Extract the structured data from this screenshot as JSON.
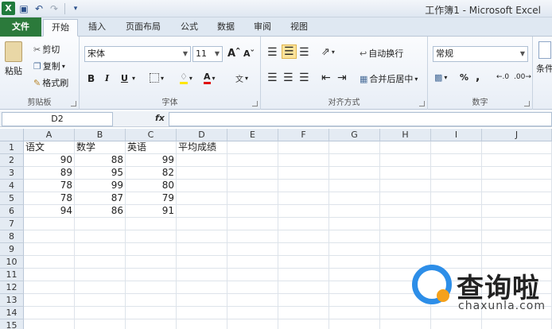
{
  "window": {
    "title": "工作簿1 - Microsoft Excel"
  },
  "tabs": [
    {
      "label": "文件"
    },
    {
      "label": "开始"
    },
    {
      "label": "插入"
    },
    {
      "label": "页面布局"
    },
    {
      "label": "公式"
    },
    {
      "label": "数据"
    },
    {
      "label": "审阅"
    },
    {
      "label": "视图"
    }
  ],
  "clipboard": {
    "paste": "粘贴",
    "cut": "剪切",
    "copy": "复制",
    "format_painter": "格式刷",
    "group": "剪贴板"
  },
  "font": {
    "name": "宋体",
    "size": "11",
    "bold": "B",
    "italic": "I",
    "underline": "U",
    "group": "字体"
  },
  "alignment": {
    "wrap": "自动换行",
    "merge": "合并后居中",
    "group": "对齐方式"
  },
  "number": {
    "format": "常规",
    "percent": "%",
    "comma": ",",
    "group": "数字"
  },
  "styles": {
    "label": "条件"
  },
  "formula_bar": {
    "name_box": "D2",
    "fx": "fx",
    "value": ""
  },
  "columns": [
    "A",
    "B",
    "C",
    "D",
    "E",
    "F",
    "G",
    "H",
    "I",
    "J"
  ],
  "rows": [
    "1",
    "2",
    "3",
    "4",
    "5",
    "6",
    "7",
    "8",
    "9",
    "10",
    "11",
    "12",
    "13",
    "14",
    "15"
  ],
  "sheet": {
    "r1": [
      "语文",
      "数学",
      "英语",
      "平均成绩"
    ],
    "r2": [
      "90",
      "88",
      "99"
    ],
    "r3": [
      "89",
      "95",
      "82"
    ],
    "r4": [
      "78",
      "99",
      "80"
    ],
    "r5": [
      "78",
      "87",
      "79"
    ],
    "r6": [
      "94",
      "86",
      "91"
    ]
  },
  "watermark": {
    "text": "查询啦",
    "url": "chaxunla.com"
  },
  "colors": {
    "file_tab": "#2b7a3b",
    "accent": "#2d8ee8",
    "orange": "#f5a11b"
  }
}
